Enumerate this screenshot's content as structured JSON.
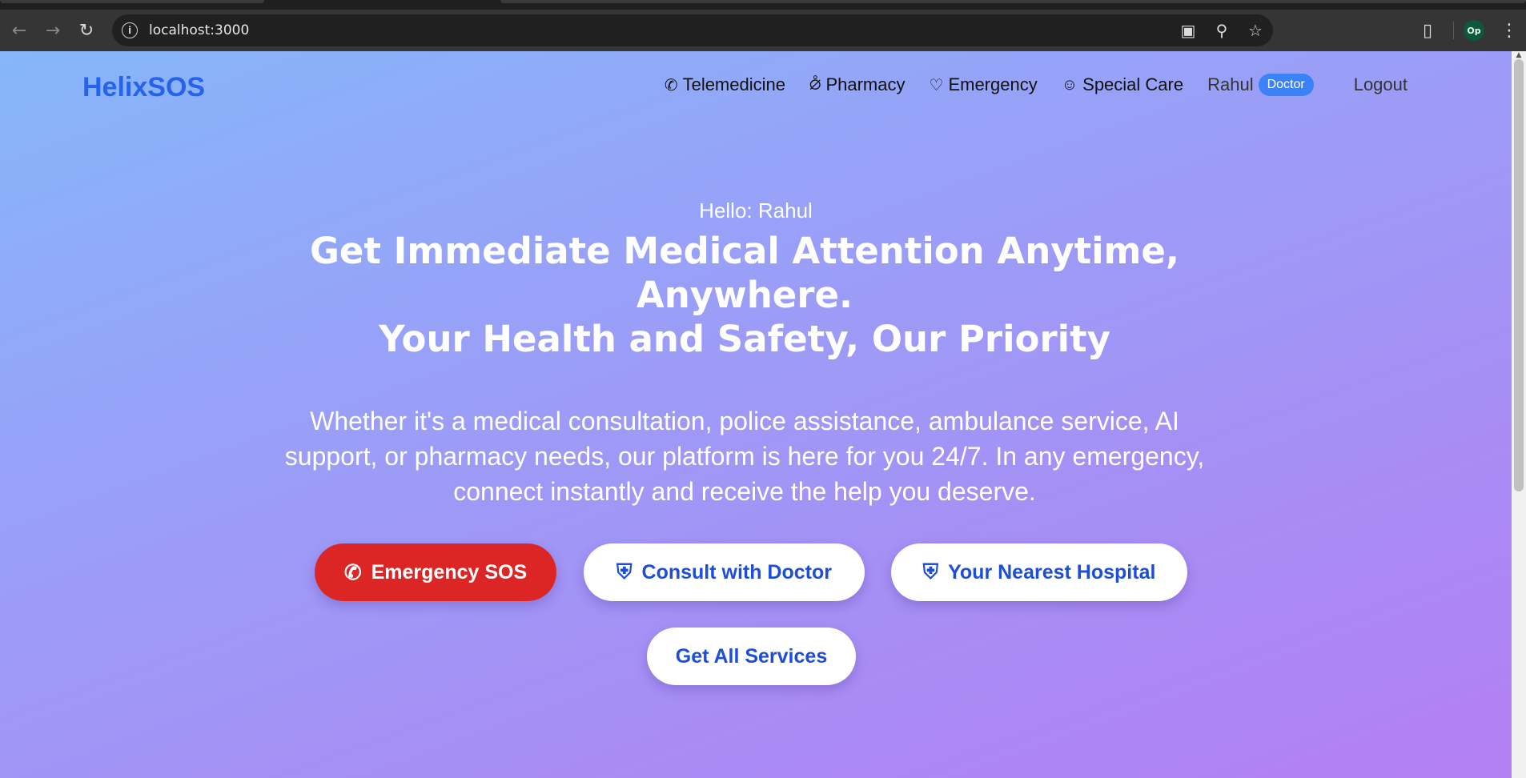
{
  "browser": {
    "url": "localhost:3000",
    "profile_initials": "Op",
    "icons": [
      "back-arrow-icon",
      "forward-arrow-icon",
      "reload-icon",
      "site-info-icon",
      "install-app-icon",
      "zoom-icon",
      "bookmark-star-icon",
      "extensions-icon",
      "menu-dots-icon"
    ]
  },
  "nav": {
    "brand": "HelixSOS",
    "links": [
      {
        "label": "Telemedicine",
        "icon": "phone-icon"
      },
      {
        "label": "Pharmacy",
        "icon": "pill-icon"
      },
      {
        "label": "Emergency",
        "icon": "heart-icon"
      },
      {
        "label": "Special Care",
        "icon": "baby-face-icon"
      }
    ],
    "user_name": "Rahul",
    "user_role": "Doctor",
    "logout": "Logout"
  },
  "hero": {
    "greeting": "Hello: Rahul",
    "headline_line1": "Get Immediate Medical Attention Anytime,",
    "headline_line2": "Anywhere.",
    "headline_line3": "Your Health and Safety, Our Priority",
    "description": "Whether it's a medical consultation, police assistance, ambulance service, AI support, or pharmacy needs, our platform is here for you 24/7. In any emergency, connect instantly and receive the help you deserve."
  },
  "actions": {
    "emergency_sos": "Emergency SOS",
    "consult_doctor": "Consult with Doctor",
    "nearest_hospital": "Your Nearest Hospital",
    "all_services": "Get All Services"
  },
  "colors": {
    "brand": "#2563eb",
    "sos_red": "#dc2626",
    "badge_blue": "#3b82f6",
    "gradient_start": "#86b6fb",
    "gradient_end": "#b47ff3"
  }
}
